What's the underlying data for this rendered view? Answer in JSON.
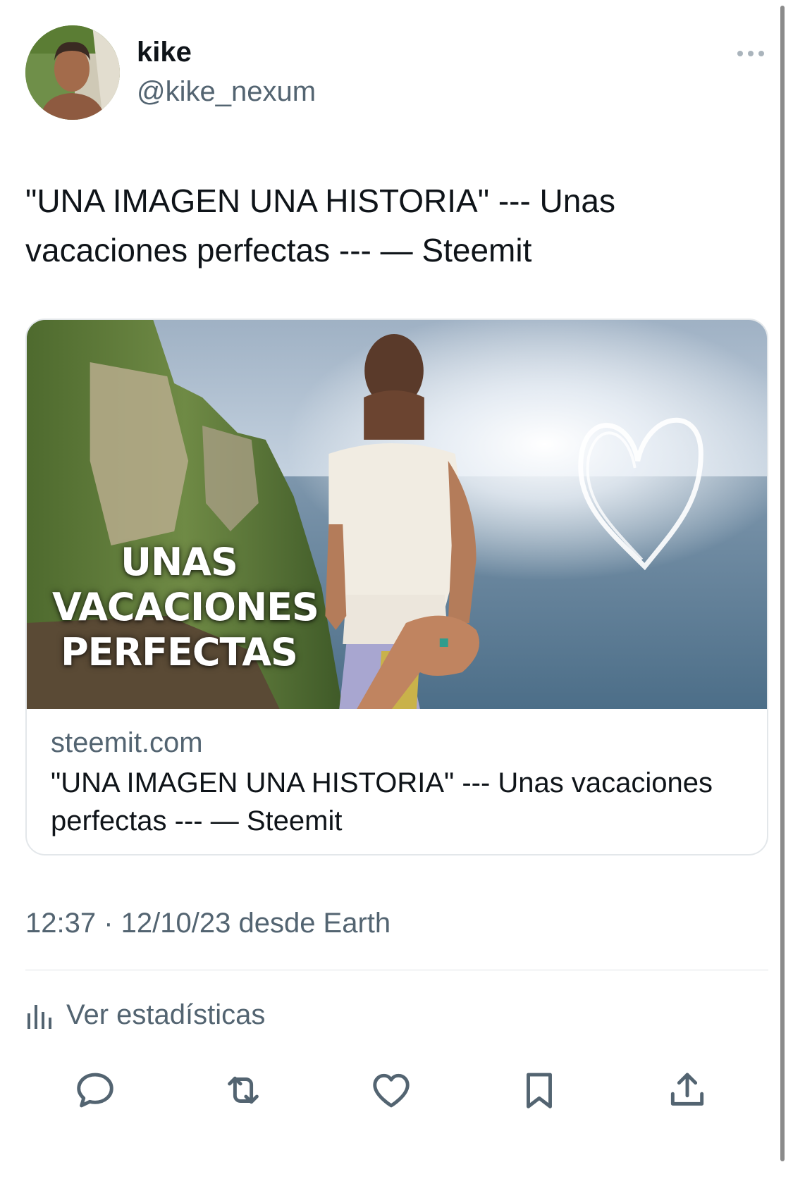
{
  "tweet": {
    "author": {
      "display_name": "kike",
      "handle": "@kike_nexum"
    },
    "text": "\"UNA IMAGEN UNA HISTORIA\" --- Unas vacaciones perfectas --- — Steemit",
    "card": {
      "image_overlay_lines": [
        "UNAS",
        "VACACIONES",
        "PERFECTAS"
      ],
      "domain": "steemit.com",
      "title": "\"UNA IMAGEN UNA HISTORIA\" --- Unas vacaciones perfectas --- — Steemit"
    },
    "meta": "12:37 · 12/10/23 desde Earth",
    "stats_label": "Ver estadísticas",
    "actions": [
      {
        "name": "reply",
        "icon": "reply-icon"
      },
      {
        "name": "retweet",
        "icon": "retweet-icon"
      },
      {
        "name": "like",
        "icon": "heart-icon"
      },
      {
        "name": "bookmark",
        "icon": "bookmark-icon"
      },
      {
        "name": "share",
        "icon": "share-icon"
      }
    ],
    "colors": {
      "primary_text": "#0f1419",
      "secondary_text": "#536471",
      "border": "#e3e7ea"
    }
  }
}
